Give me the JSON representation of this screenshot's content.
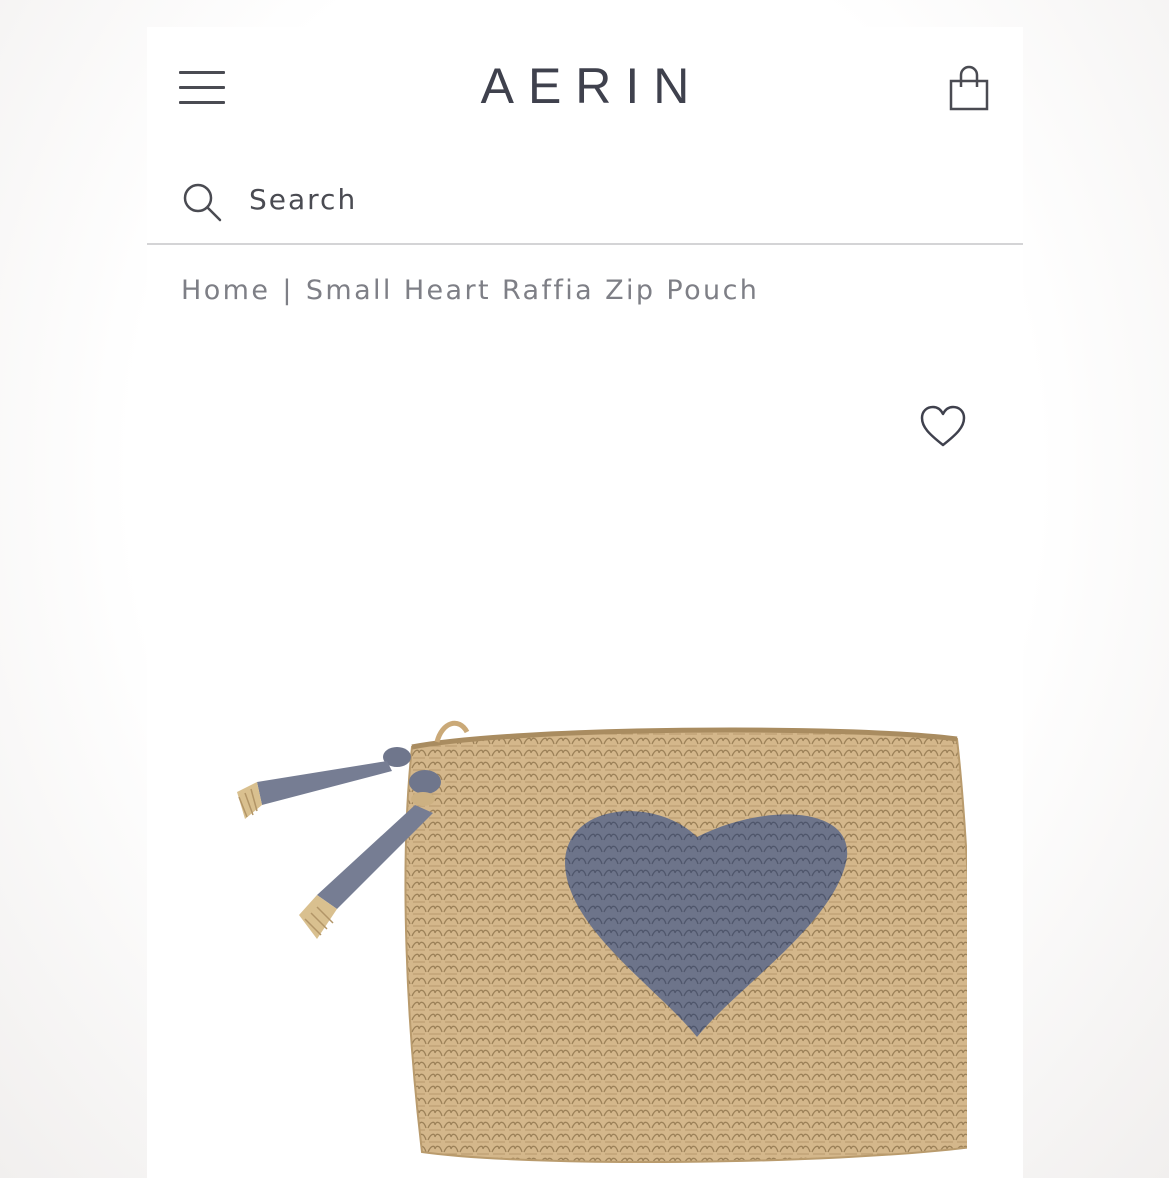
{
  "header": {
    "brand": "AERIN",
    "menu_icon": "hamburger-menu-icon",
    "bag_icon": "shopping-bag-icon"
  },
  "search": {
    "icon": "search-icon",
    "placeholder": "Search"
  },
  "breadcrumb": {
    "home": "Home",
    "separator": "|",
    "current": "Small Heart Raffia Zip Pouch"
  },
  "product": {
    "wishlist_icon": "heart-outline-icon",
    "image_alt": "Small Heart Raffia Zip Pouch"
  },
  "colors": {
    "text_dark": "#3f414d",
    "text_muted": "#7e7f86",
    "raffia": "#d2b487",
    "heart_blue": "#6c7389"
  }
}
